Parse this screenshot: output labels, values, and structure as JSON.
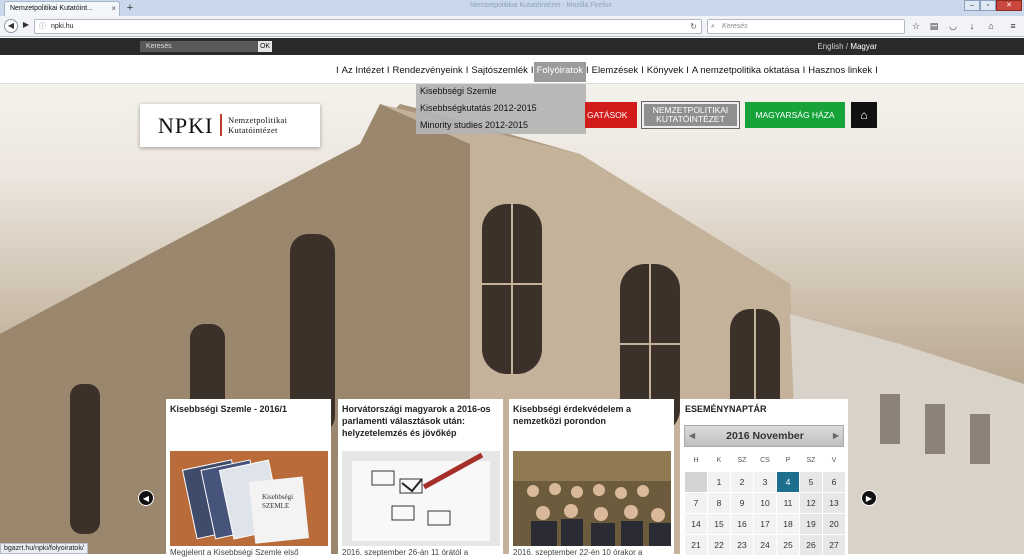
{
  "browser": {
    "tab_title": "Nemzetpolitikai Kutatóint...",
    "tab_close": "×",
    "new_tab": "+",
    "ghost_title": "Nemzetpolitikai Kutatóintézet - Mozilla Firefox",
    "url": "npki.hu",
    "search_placeholder": "Keresés",
    "status_url": "bgazrt.hu/npki/folyoiratok/"
  },
  "site_top": {
    "search_placeholder": "Keresés",
    "ok_label": "OK",
    "lang_en": "English",
    "lang_sep": " / ",
    "lang_hu": "Magyar"
  },
  "nav": {
    "items": [
      "Az Intézet",
      "Rendezvényeink",
      "Sajtószemlék",
      "Folyóiratok",
      "Elemzések",
      "Könyvek",
      "A nemzetpolitika oktatása",
      "Hasznos linkek"
    ],
    "sep": "I"
  },
  "dropdown": {
    "items": [
      "Kisebbségi Szemle",
      "Kisebbségkutatás 2012-2015",
      "Minority studies 2012-2015"
    ]
  },
  "logo": {
    "mark": "NPKI",
    "line1": "Nemzetpolitikai",
    "line2": "Kutatóintézet"
  },
  "header_buttons": {
    "red": "GATÁSOK",
    "gray_line1": "NEMZETPOLITIKAI",
    "gray_line2": "KUTATÓINTÉZET",
    "green": "MAGYARSÁG HÁZA",
    "home": "⌂"
  },
  "slider": {
    "prev": "◀",
    "next": "▶"
  },
  "cards": [
    {
      "title": "Kisebbségi Szemle - 2016/1",
      "foot": "Megjelent a Kisebbségi Szemle első"
    },
    {
      "title": "Horvátországi magyarok a 2016-os parlamenti választások után: helyzetelemzés és jövőkép",
      "foot": "2016. szeptember 26-án 11 órától a"
    },
    {
      "title": "Kisebbségi érdekvédelem a nemzetközi porondon",
      "foot": "2016. szeptember 22-én 10 órakor a"
    }
  ],
  "card_book_text": "Kisebbségi\nSZEMLE",
  "calendar": {
    "title": "ESEMÉNYNAPTÁR",
    "month": "2016 November",
    "prev": "◀",
    "next": "▶",
    "weekdays": [
      "H",
      "K",
      "SZ",
      "CS",
      "P",
      "SZ",
      "V"
    ],
    "rows": [
      [
        "",
        "1",
        "2",
        "3",
        "4",
        "5",
        "6"
      ],
      [
        "7",
        "8",
        "9",
        "10",
        "11",
        "12",
        "13"
      ],
      [
        "14",
        "15",
        "16",
        "17",
        "18",
        "19",
        "20"
      ],
      [
        "21",
        "22",
        "23",
        "24",
        "25",
        "26",
        "27"
      ]
    ],
    "today": "4"
  },
  "colors": {
    "accent_red": "#d21b1b",
    "accent_green": "#17a33a",
    "today": "#1d6f8e"
  }
}
